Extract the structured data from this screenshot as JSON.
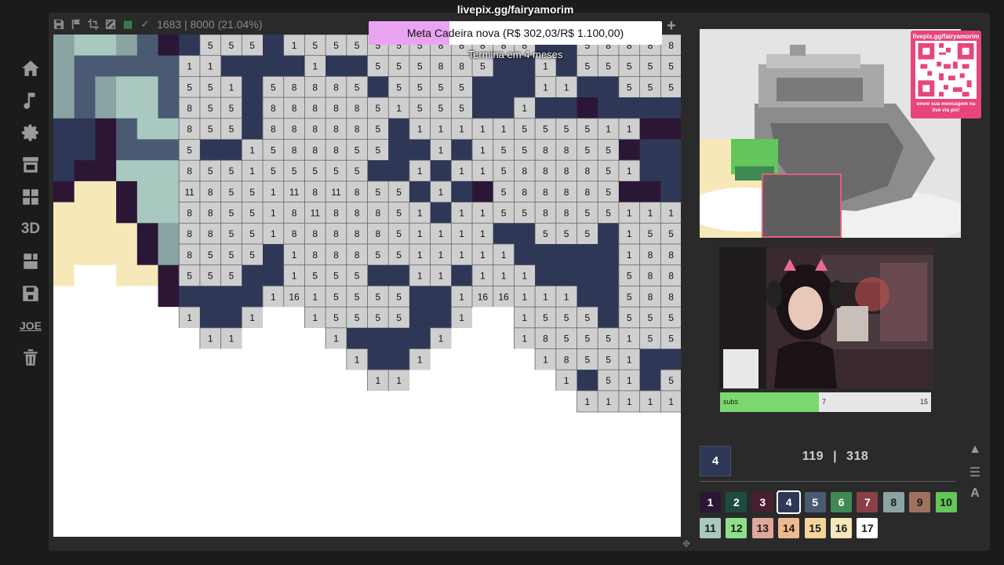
{
  "stream": {
    "livepix_title": "livepix.gg/fairyamorim",
    "goal": {
      "text": "Meta Cadeira nova (R$ 302,03/R$ 1.100,00)",
      "subtext": "Termina em 4 meses",
      "progress": 0.2746
    },
    "qr": {
      "title": "livepix.gg/fairyamorim",
      "caption": "envie sua mensagem na live via pix!"
    },
    "subs": {
      "label": "subs",
      "current": "7",
      "target": "15",
      "progress": 0.4667
    }
  },
  "toolbar": {
    "counter": "1683 | 8000 (21.04%)",
    "icons": [
      "save-icon",
      "flag-icon",
      "crop-icon",
      "hatch-icon",
      "palette-icon",
      "check-icon"
    ]
  },
  "sidebar": {
    "items": [
      {
        "name": "home-icon"
      },
      {
        "name": "music-icon"
      },
      {
        "name": "gear-icon"
      },
      {
        "name": "store-icon"
      },
      {
        "name": "grid-icon"
      },
      {
        "name": "3d",
        "text": "3D"
      },
      {
        "name": "export-icon"
      },
      {
        "name": "floppy-icon"
      },
      {
        "name": "text",
        "text": "JOE"
      },
      {
        "name": "trash-icon"
      }
    ]
  },
  "palette_panel": {
    "current_color_number": "4",
    "painted": "119",
    "separator": "|",
    "total": "318",
    "selected": 4,
    "colors": [
      {
        "n": "1",
        "bg": "#2c1636",
        "fg": "#ffffff"
      },
      {
        "n": "2",
        "bg": "#1f4a44",
        "fg": "#ffffff"
      },
      {
        "n": "3",
        "bg": "#4a1f33",
        "fg": "#ffffff"
      },
      {
        "n": "4",
        "bg": "#2f3757",
        "fg": "#ffffff"
      },
      {
        "n": "5",
        "bg": "#4a5a72",
        "fg": "#ffffff"
      },
      {
        "n": "6",
        "bg": "#3e8a52",
        "fg": "#ffffff"
      },
      {
        "n": "7",
        "bg": "#8a4046",
        "fg": "#ffffff"
      },
      {
        "n": "8",
        "bg": "#8aa4a4",
        "fg": "#1a1a1a"
      },
      {
        "n": "9",
        "bg": "#a07060",
        "fg": "#1a1a1a"
      },
      {
        "n": "10",
        "bg": "#62c65a",
        "fg": "#1a1a1a"
      },
      {
        "n": "11",
        "bg": "#a8c8c0",
        "fg": "#1a1a1a"
      },
      {
        "n": "12",
        "bg": "#8fe08a",
        "fg": "#1a1a1a"
      },
      {
        "n": "13",
        "bg": "#e0a89a",
        "fg": "#1a1a1a"
      },
      {
        "n": "14",
        "bg": "#f0b890",
        "fg": "#1a1a1a"
      },
      {
        "n": "15",
        "bg": "#f4d69a",
        "fg": "#1a1a1a"
      },
      {
        "n": "16",
        "bg": "#f6e8b8",
        "fg": "#1a1a1a"
      },
      {
        "n": "17",
        "bg": "#ffffff",
        "fg": "#1a1a1a"
      }
    ]
  },
  "pixel_grid": {
    "cols": 30,
    "rows": 18,
    "legend": {
      "A": "#2c1636",
      "D": "#2f3757",
      "G": "#4a5a72",
      "L": "#8aa4a4",
      "M": "#a8c8c0",
      "C": "#f6e8b8",
      "W": "#ffffff"
    },
    "unpainted_color": "#cfcfcf",
    "rows_data": [
      "L,M,M,L,G,A,D,5,5,5,D,1,5,5,5,5,5,5,8,8,8,8,8,D,D,5,8,8,8,8",
      "L,G,G,G,G,G,1,1,D,D,D,D,1,D,D,5,5,5,8,8,5,D,D,1,D,5,5,5,5,5",
      "L,G,L,M,M,G,5,5,1,D,5,8,8,8,5,D,5,5,5,5,D,D,D,1,1,D,D,5,5,5",
      "L,G,L,M,M,G,8,5,5,D,8,8,8,8,8,5,1,5,5,5,D,D,1,D,D,A,D,D,D,D",
      "D,D,A,G,M,M,8,5,5,D,8,8,8,8,8,5,D,1,1,1,1,1,5,5,5,5,1,1,A,A",
      "D,D,A,G,G,G,5,D,D,1,5,8,8,8,5,5,D,D,1,D,1,5,5,8,8,5,5,A,D,D",
      "D,A,A,M,M,M,8,5,5,1,5,5,5,5,5,D,D,1,D,1,1,5,8,8,8,8,5,1,D,D",
      "A,C,C,A,M,M,11,8,5,5,1,11,8,11,8,5,5,D,1,D,A,5,8,8,8,8,5,A,A,D",
      "C,C,C,A,M,M,8,8,5,5,1,8,11,8,8,8,5,1,D,1,1,5,5,8,8,5,5,1,1,1",
      "C,C,C,C,A,L,8,8,5,5,1,8,8,8,8,8,5,1,1,1,1,D,D,5,5,5,D,1,5,5",
      "C,C,C,C,A,L,8,5,5,5,D,1,8,8,8,5,5,1,1,1,1,1,D,D,D,D,D,1,8,8",
      "C,W,W,C,C,A,5,5,5,D,D,1,5,5,5,D,D,1,1,D,1,1,1,D,D,D,D,5,8,8",
      "W,W,W,W,W,A,D,D,D,D,1,16,1,5,5,5,5,D,D,1,16,16,1,1,1,D,D,5,8,8",
      "W,W,W,W,W,W,1,D,D,1,W,W,1,5,5,5,5,D,D,1,W,W,1,5,5,5,D,5,5,5",
      "W,W,W,W,W,W,W,1,1,W,W,W,W,1,D,D,D,D,1,W,W,W,1,8,5,5,5,1,5,5",
      "W,W,W,W,W,W,W,W,W,W,W,W,W,W,1,D,D,1,W,W,W,W,W,1,8,5,5,1,D,D",
      "W,W,W,W,W,W,W,W,W,W,W,W,W,W,W,1,1,W,W,W,W,W,W,W,1,D,5,1,D,5",
      "W,W,W,W,W,W,W,W,W,W,W,W,W,W,W,W,W,W,W,W,W,W,W,W,W,1,1,1,1,1"
    ]
  }
}
